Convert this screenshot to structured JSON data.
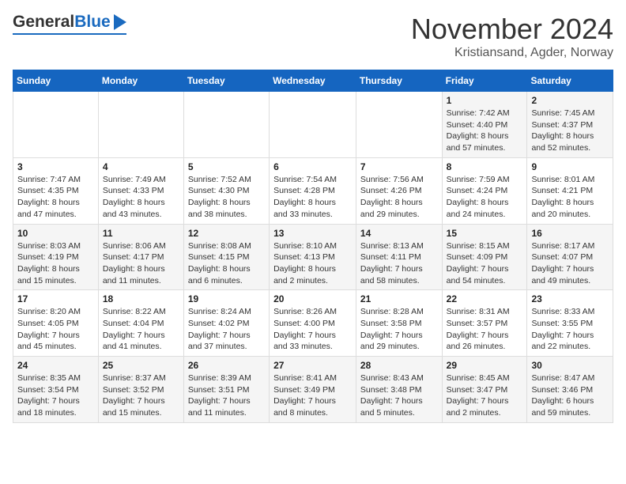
{
  "header": {
    "logo_general": "General",
    "logo_blue": "Blue",
    "main_title": "November 2024",
    "sub_title": "Kristiansand, Agder, Norway"
  },
  "columns": [
    "Sunday",
    "Monday",
    "Tuesday",
    "Wednesday",
    "Thursday",
    "Friday",
    "Saturday"
  ],
  "weeks": [
    {
      "cells": [
        {
          "day": "",
          "detail": ""
        },
        {
          "day": "",
          "detail": ""
        },
        {
          "day": "",
          "detail": ""
        },
        {
          "day": "",
          "detail": ""
        },
        {
          "day": "",
          "detail": ""
        },
        {
          "day": "1",
          "detail": "Sunrise: 7:42 AM\nSunset: 4:40 PM\nDaylight: 8 hours\nand 57 minutes."
        },
        {
          "day": "2",
          "detail": "Sunrise: 7:45 AM\nSunset: 4:37 PM\nDaylight: 8 hours\nand 52 minutes."
        }
      ]
    },
    {
      "cells": [
        {
          "day": "3",
          "detail": "Sunrise: 7:47 AM\nSunset: 4:35 PM\nDaylight: 8 hours\nand 47 minutes."
        },
        {
          "day": "4",
          "detail": "Sunrise: 7:49 AM\nSunset: 4:33 PM\nDaylight: 8 hours\nand 43 minutes."
        },
        {
          "day": "5",
          "detail": "Sunrise: 7:52 AM\nSunset: 4:30 PM\nDaylight: 8 hours\nand 38 minutes."
        },
        {
          "day": "6",
          "detail": "Sunrise: 7:54 AM\nSunset: 4:28 PM\nDaylight: 8 hours\nand 33 minutes."
        },
        {
          "day": "7",
          "detail": "Sunrise: 7:56 AM\nSunset: 4:26 PM\nDaylight: 8 hours\nand 29 minutes."
        },
        {
          "day": "8",
          "detail": "Sunrise: 7:59 AM\nSunset: 4:24 PM\nDaylight: 8 hours\nand 24 minutes."
        },
        {
          "day": "9",
          "detail": "Sunrise: 8:01 AM\nSunset: 4:21 PM\nDaylight: 8 hours\nand 20 minutes."
        }
      ]
    },
    {
      "cells": [
        {
          "day": "10",
          "detail": "Sunrise: 8:03 AM\nSunset: 4:19 PM\nDaylight: 8 hours\nand 15 minutes."
        },
        {
          "day": "11",
          "detail": "Sunrise: 8:06 AM\nSunset: 4:17 PM\nDaylight: 8 hours\nand 11 minutes."
        },
        {
          "day": "12",
          "detail": "Sunrise: 8:08 AM\nSunset: 4:15 PM\nDaylight: 8 hours\nand 6 minutes."
        },
        {
          "day": "13",
          "detail": "Sunrise: 8:10 AM\nSunset: 4:13 PM\nDaylight: 8 hours\nand 2 minutes."
        },
        {
          "day": "14",
          "detail": "Sunrise: 8:13 AM\nSunset: 4:11 PM\nDaylight: 7 hours\nand 58 minutes."
        },
        {
          "day": "15",
          "detail": "Sunrise: 8:15 AM\nSunset: 4:09 PM\nDaylight: 7 hours\nand 54 minutes."
        },
        {
          "day": "16",
          "detail": "Sunrise: 8:17 AM\nSunset: 4:07 PM\nDaylight: 7 hours\nand 49 minutes."
        }
      ]
    },
    {
      "cells": [
        {
          "day": "17",
          "detail": "Sunrise: 8:20 AM\nSunset: 4:05 PM\nDaylight: 7 hours\nand 45 minutes."
        },
        {
          "day": "18",
          "detail": "Sunrise: 8:22 AM\nSunset: 4:04 PM\nDaylight: 7 hours\nand 41 minutes."
        },
        {
          "day": "19",
          "detail": "Sunrise: 8:24 AM\nSunset: 4:02 PM\nDaylight: 7 hours\nand 37 minutes."
        },
        {
          "day": "20",
          "detail": "Sunrise: 8:26 AM\nSunset: 4:00 PM\nDaylight: 7 hours\nand 33 minutes."
        },
        {
          "day": "21",
          "detail": "Sunrise: 8:28 AM\nSunset: 3:58 PM\nDaylight: 7 hours\nand 29 minutes."
        },
        {
          "day": "22",
          "detail": "Sunrise: 8:31 AM\nSunset: 3:57 PM\nDaylight: 7 hours\nand 26 minutes."
        },
        {
          "day": "23",
          "detail": "Sunrise: 8:33 AM\nSunset: 3:55 PM\nDaylight: 7 hours\nand 22 minutes."
        }
      ]
    },
    {
      "cells": [
        {
          "day": "24",
          "detail": "Sunrise: 8:35 AM\nSunset: 3:54 PM\nDaylight: 7 hours\nand 18 minutes."
        },
        {
          "day": "25",
          "detail": "Sunrise: 8:37 AM\nSunset: 3:52 PM\nDaylight: 7 hours\nand 15 minutes."
        },
        {
          "day": "26",
          "detail": "Sunrise: 8:39 AM\nSunset: 3:51 PM\nDaylight: 7 hours\nand 11 minutes."
        },
        {
          "day": "27",
          "detail": "Sunrise: 8:41 AM\nSunset: 3:49 PM\nDaylight: 7 hours\nand 8 minutes."
        },
        {
          "day": "28",
          "detail": "Sunrise: 8:43 AM\nSunset: 3:48 PM\nDaylight: 7 hours\nand 5 minutes."
        },
        {
          "day": "29",
          "detail": "Sunrise: 8:45 AM\nSunset: 3:47 PM\nDaylight: 7 hours\nand 2 minutes."
        },
        {
          "day": "30",
          "detail": "Sunrise: 8:47 AM\nSunset: 3:46 PM\nDaylight: 6 hours\nand 59 minutes."
        }
      ]
    }
  ]
}
